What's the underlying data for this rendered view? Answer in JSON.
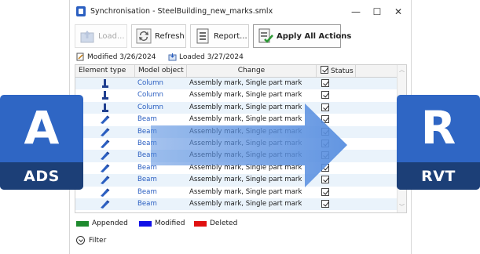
{
  "window": {
    "title": "Synchronisation - SteelBuilding_new_marks.smlx",
    "controls": {
      "minimize": "—",
      "maximize": "☐",
      "close": "✕"
    }
  },
  "toolbar": {
    "load_label": "Load...",
    "refresh_label": "Refresh",
    "report_label": "Report...",
    "apply_all_label": "Apply All Actions"
  },
  "info": {
    "modified": "Modified 3/26/2024",
    "loaded": "Loaded 3/27/2024"
  },
  "grid": {
    "headers": [
      "Element type",
      "Model object",
      "Change",
      "Status"
    ],
    "rows": [
      {
        "model_object": "Column",
        "change": "Assembly mark, Single part mark",
        "status_checked": true,
        "element_icon": "column-icon"
      },
      {
        "model_object": "Column",
        "change": "Assembly mark, Single part mark",
        "status_checked": true,
        "element_icon": "column-icon"
      },
      {
        "model_object": "Column",
        "change": "Assembly mark, Single part mark",
        "status_checked": true,
        "element_icon": "column-icon"
      },
      {
        "model_object": "Beam",
        "change": "Assembly mark, Single part mark",
        "status_checked": true,
        "element_icon": "beam-icon"
      },
      {
        "model_object": "Beam",
        "change": "Assembly mark, Single part mark",
        "status_checked": true,
        "element_icon": "beam-icon"
      },
      {
        "model_object": "Beam",
        "change": "Assembly mark, Single part mark",
        "status_checked": true,
        "element_icon": "beam-icon"
      },
      {
        "model_object": "Beam",
        "change": "Assembly mark, Single part mark",
        "status_checked": true,
        "element_icon": "beam-icon"
      },
      {
        "model_object": "Beam",
        "change": "Assembly mark, Single part mark",
        "status_checked": true,
        "element_icon": "beam-icon"
      },
      {
        "model_object": "Beam",
        "change": "Assembly mark, Single part mark",
        "status_checked": true,
        "element_icon": "beam-icon"
      },
      {
        "model_object": "Beam",
        "change": "Assembly mark, Single part mark",
        "status_checked": true,
        "element_icon": "beam-icon"
      },
      {
        "model_object": "Beam",
        "change": "Assembly mark, Single part mark",
        "status_checked": true,
        "element_icon": "beam-icon"
      }
    ]
  },
  "legend": {
    "appended": "Appended",
    "modified": "Modified",
    "deleted": "Deleted",
    "colors": {
      "appended": "#1e8a2e",
      "modified": "#1010e6",
      "deleted": "#e01010"
    }
  },
  "filter_label": "Filter",
  "overlay": {
    "left_logo": {
      "letter": "A",
      "caption": "ADS",
      "color": "#2f66c4"
    },
    "right_logo": {
      "letter": "R",
      "caption": "RVT",
      "color": "#2f66c4"
    },
    "arrow_color": "#5a90e0"
  }
}
